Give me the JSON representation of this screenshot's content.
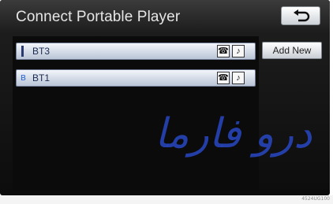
{
  "screen": {
    "title": "Connect Portable Player"
  },
  "toolbar": {
    "back_icon": "return-arrow-icon",
    "add_new_label": "Add New"
  },
  "devices": [
    {
      "name": "BT3",
      "status_icon": "selected-marker",
      "icons": [
        "phone-icon",
        "audio-icon"
      ]
    },
    {
      "name": "BT1",
      "status_icon": "bluetooth-icon",
      "icons": [
        "phone-icon",
        "audio-icon"
      ]
    }
  ],
  "glyphs": {
    "phone": "☎",
    "audio": "♪",
    "bluetooth": "ʙ"
  },
  "watermark": {
    "text": "درو فارما"
  },
  "footer": {
    "code": "4524UG100"
  },
  "colors": {
    "accent": "#2846be",
    "row_fill": "#dfe5ef",
    "background": "#141414"
  }
}
